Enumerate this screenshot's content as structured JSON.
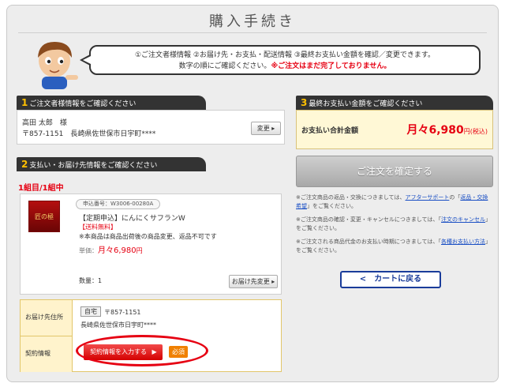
{
  "page": {
    "title": "購入手続き"
  },
  "guide": {
    "line1": "①ご注文者様情報 ②お届け先・お支払・配送情報 ③最終お支払い金額を確認／変更できます。",
    "line2": "数字の順にご確認ください。",
    "line2_warn": "※ご注文はまだ完了しておりません。"
  },
  "section1": {
    "number": "1",
    "title": "ご注文者様情報をご確認ください",
    "name": "高田 太郎　様",
    "address": "〒857-1151　長崎県佐世保市日宇町****",
    "change_label": "変更"
  },
  "section2": {
    "number": "2",
    "title": "支払い・お届け先情報をご確認ください",
    "group_label": "1組目/1組中",
    "product": {
      "code": "申込番号：W3006-00280A",
      "name": "【定期申込】にんにくサフランW",
      "free_shipping": "【送料無料】",
      "note": "※本商品は商品出荷後の商品変更、返品不可です",
      "price_label": "単価：",
      "price": "月々6,980",
      "price_unit": "円",
      "quantity": "数量：1",
      "delivery_button": "お届け先変更",
      "thumb_text": "匠の極"
    },
    "delivery_address": {
      "label": "お届け先住所",
      "tag": "自宅",
      "zip": "〒857-1151",
      "address": "長崎県佐世保市日宇町****"
    },
    "contract": {
      "label": "契約情報",
      "button": "契約情報を入力する",
      "required": "必須"
    }
  },
  "section3": {
    "number": "3",
    "title": "最終お支払い金額をご確認ください",
    "total_label": "お支払い合計金額",
    "total_value": "月々6,980",
    "total_unit": "円(税込)",
    "confirm_button": "ご注文を確定する",
    "note1_a": "※ご注文商品の返品・交換につきましては、",
    "note1_link1": "アフターサポート",
    "note1_b": "の「",
    "note1_link2": "返品・交換希望",
    "note1_c": "」をご覧ください。",
    "note2_a": "※ご注文商品の確認・変更・キャンセルにつきましては、「",
    "note2_link": "注文のキャンセル",
    "note2_b": "」をご覧ください。",
    "note3_a": "※ご注文される商品代金のお支払い時期につきましては、「",
    "note3_link": "各種お支払い方法",
    "note3_b": "」をご覧ください。",
    "back_button": "カートに戻る",
    "back_icon": "chevron-left-icon"
  },
  "colors": {
    "accent_red": "#e60012",
    "header_dark": "#333333",
    "section_number": "#ffc000",
    "link_blue": "#1a4fc4",
    "total_bg": "#fff8d6"
  }
}
